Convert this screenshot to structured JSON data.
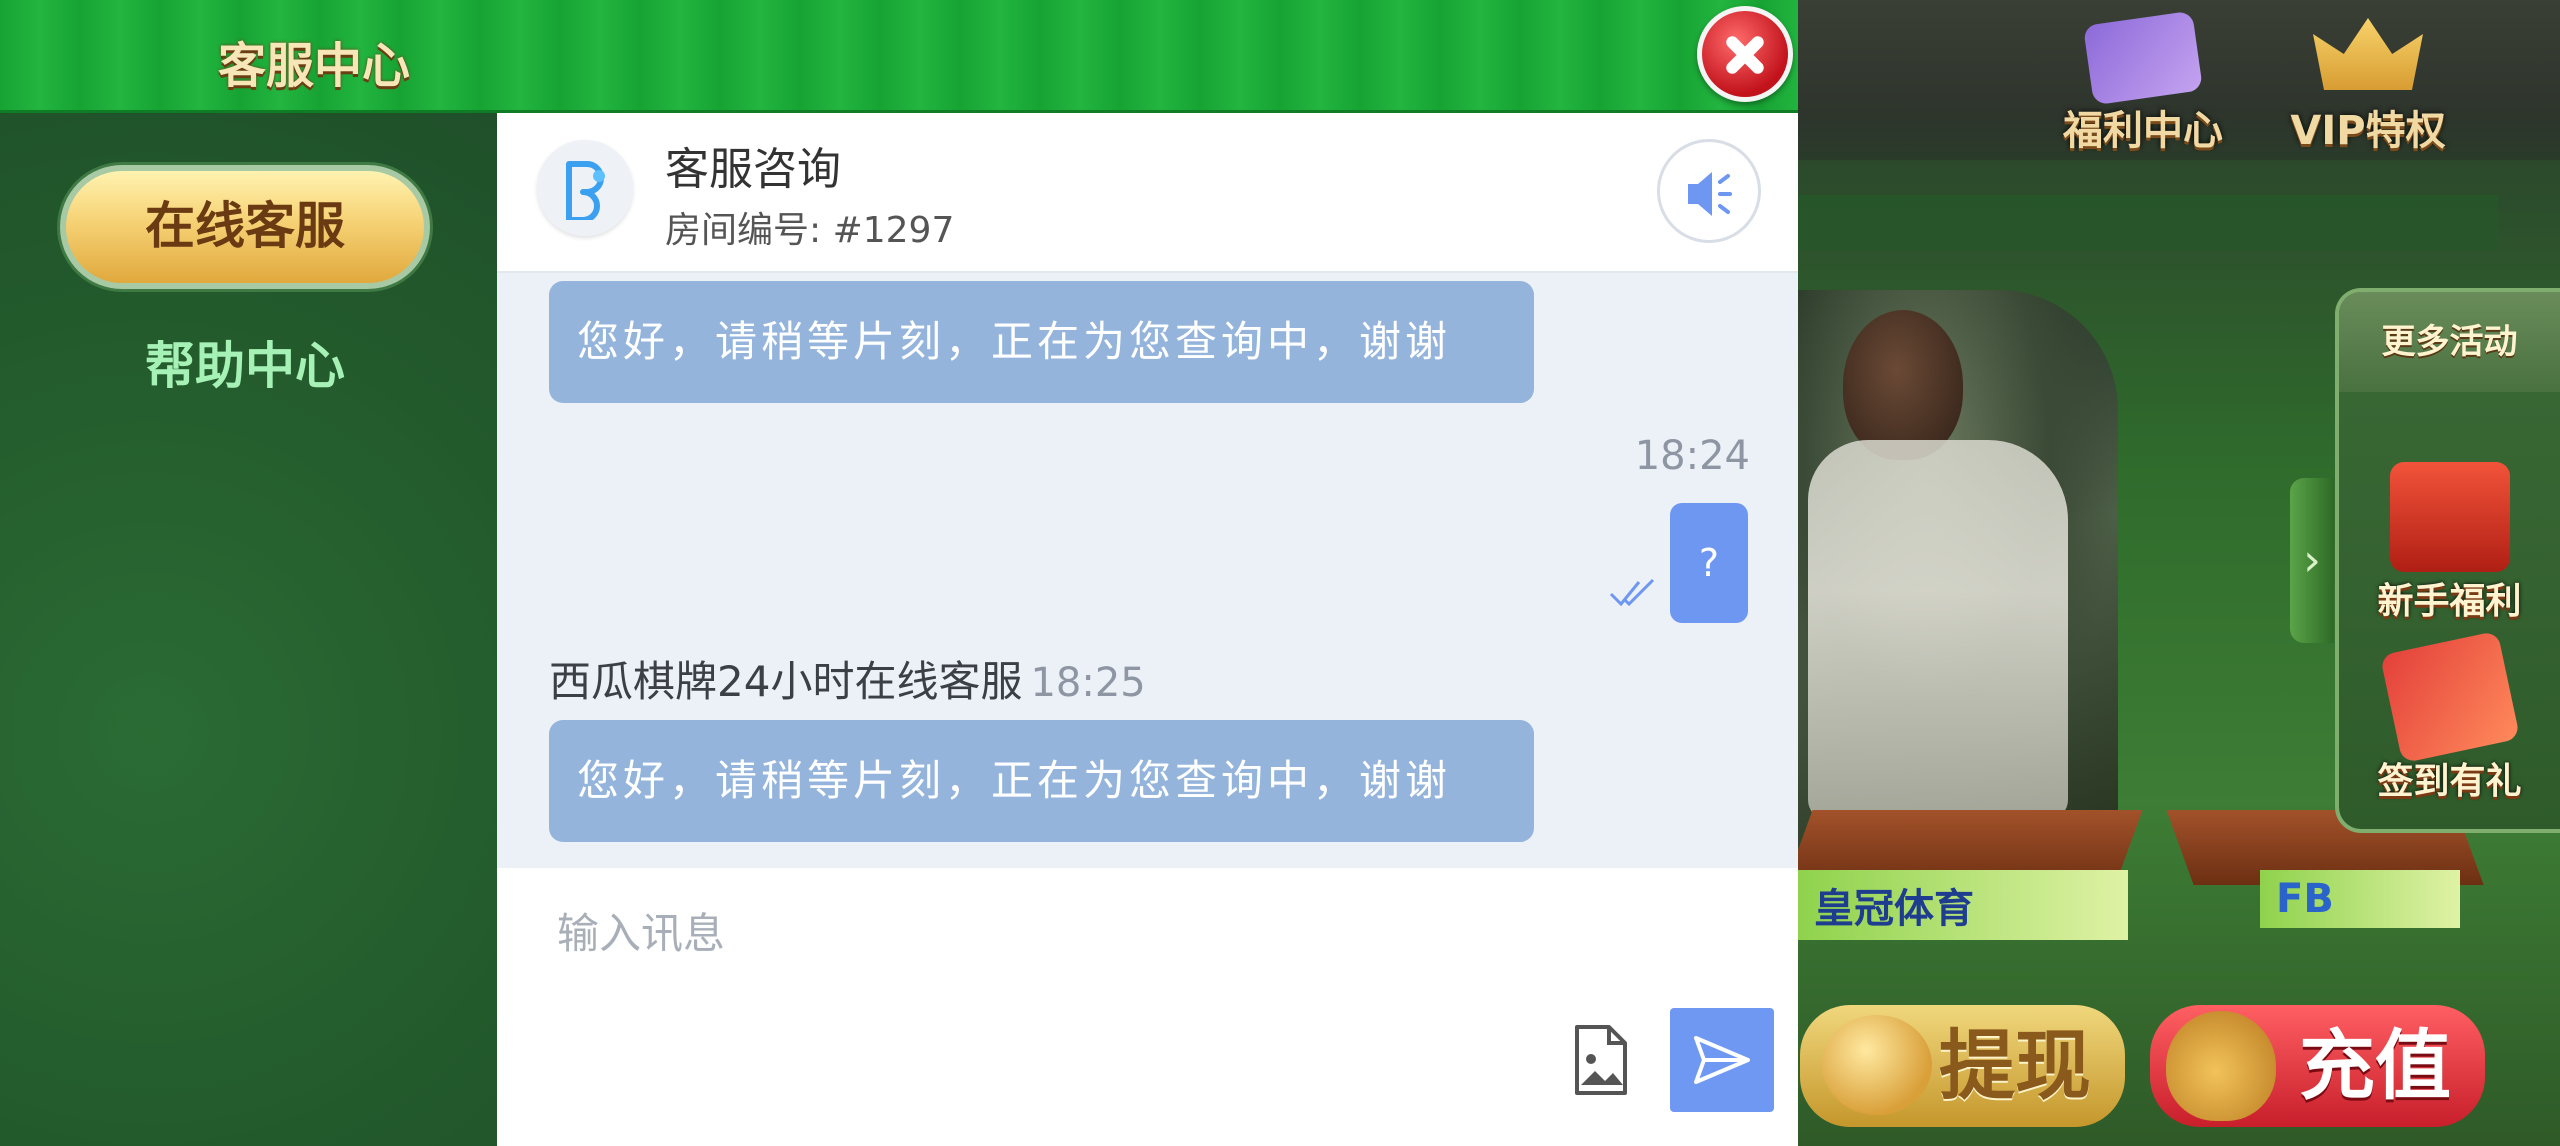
{
  "modal": {
    "title": "客服中心",
    "close_icon": "close-icon",
    "sidebar": {
      "tabs": [
        {
          "label": "在线客服",
          "active": true
        },
        {
          "label": "帮助中心",
          "active": false
        }
      ]
    },
    "chat": {
      "title": "客服咨询",
      "room_number": "房间编号: #1297",
      "sound_icon": "speaker-icon",
      "messages": [
        {
          "from": "agent",
          "text": "您好，请稍等片刻，正在为您查询中，谢谢"
        },
        {
          "from": "user",
          "time": "18:24",
          "text": "?",
          "status": "read"
        },
        {
          "from": "agent",
          "sender": "西瓜棋牌24小时在线客服",
          "time": "18:25",
          "text": "您好，请稍等片刻，正在为您查询中，谢谢"
        }
      ],
      "input": {
        "placeholder": "输入讯息",
        "value": ""
      },
      "file_icon": "image-file-icon",
      "send_icon": "send-icon"
    }
  },
  "background_game": {
    "top_icons": [
      {
        "label": "福利中心"
      },
      {
        "label": "VIP特权"
      }
    ],
    "more_activities": {
      "title": "更多活动",
      "items": [
        {
          "label": "新手福利"
        },
        {
          "label": "签到有礼"
        }
      ]
    },
    "banners": [
      {
        "label": "皇冠体育"
      },
      {
        "label": "FB"
      }
    ],
    "buttons": {
      "withdraw": "提现",
      "recharge": "充值"
    }
  },
  "colors": {
    "header_green": "#1fae3a",
    "sidebar_green": "#235a2c",
    "agent_bubble": "#94b4dc",
    "user_bubble": "#6e97f2",
    "send_button": "#6f98f3",
    "chat_bg": "#ecf0f7"
  }
}
